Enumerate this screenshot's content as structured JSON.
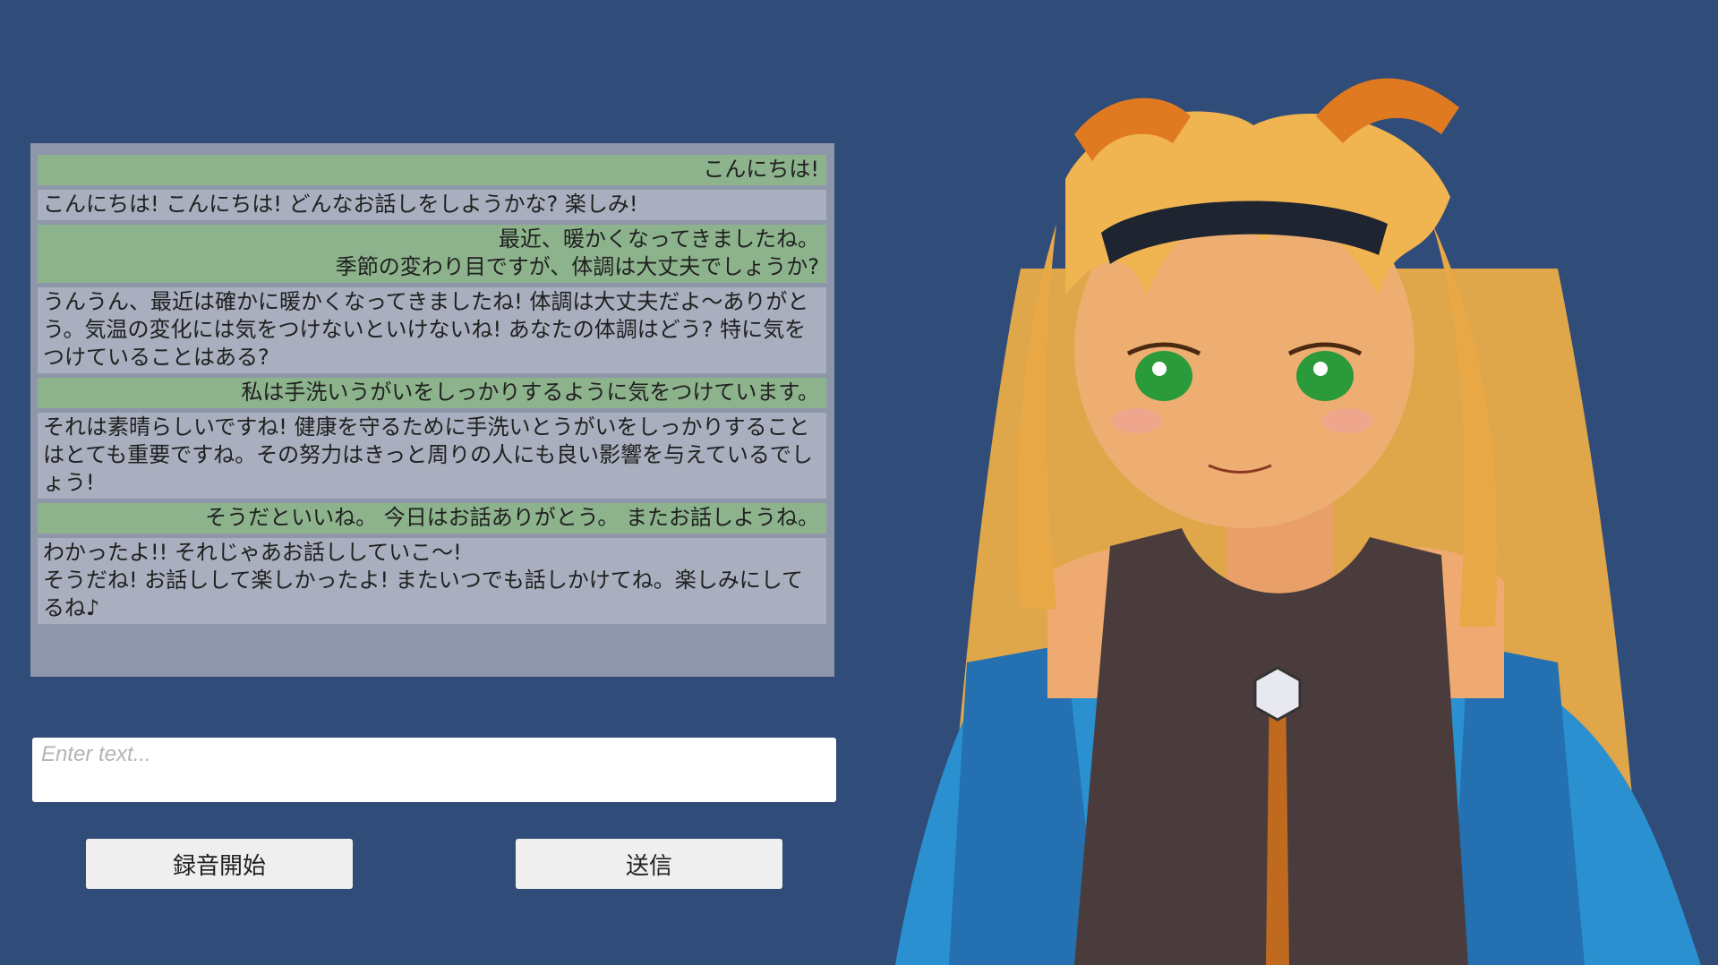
{
  "chat": {
    "messages": [
      {
        "role": "user",
        "text": "こんにちは!"
      },
      {
        "role": "ai",
        "text": "こんにちは! こんにちは! どんなお話しをしようかな? 楽しみ!"
      },
      {
        "role": "user",
        "text": "最近、暖かくなってきましたね。\n季節の変わり目ですが、体調は大丈夫でしょうか?"
      },
      {
        "role": "ai",
        "text": "うんうん、最近は確かに暖かくなってきましたね! 体調は大丈夫だよ～ありがとう。気温の変化には気をつけないといけないね! あなたの体調はどう? 特に気をつけていることはある?"
      },
      {
        "role": "user",
        "text": "私は手洗いうがいをしっかりするように気をつけています。"
      },
      {
        "role": "ai",
        "text": "それは素晴らしいですね! 健康を守るために手洗いとうがいをしっかりすることはとても重要ですね。その努力はきっと周りの人にも良い影響を与えているでしょう!"
      },
      {
        "role": "user",
        "text": "そうだといいね。 今日はお話ありがとう。 またお話しようね。"
      },
      {
        "role": "ai",
        "text": "わかったよ!! それじゃあお話ししていこ～!\nそうだね! お話しして楽しかったよ! またいつでも話しかけてね。楽しみにしてるね♪"
      }
    ]
  },
  "input": {
    "placeholder": "Enter text...",
    "value": ""
  },
  "buttons": {
    "record_label": "録音開始",
    "send_label": "送信"
  },
  "colors": {
    "background": "#304c79",
    "panel": "#8e96aa",
    "user_bubble": "#8db38d",
    "ai_bubble": "#a9afbe",
    "button": "#efefef"
  },
  "avatar": {
    "icon": "anime-character-avatar"
  }
}
